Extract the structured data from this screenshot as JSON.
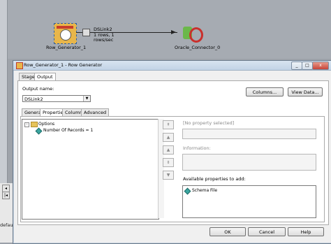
{
  "canvas": {
    "stages": [
      {
        "name": "Row_Generator_1"
      },
      {
        "name": "Oracle_Connector_0"
      }
    ],
    "link": {
      "name": "DSLink2",
      "rate_line1": "1 rows, 1",
      "rate_line2": "rows/sec"
    },
    "bottom_label": "default"
  },
  "dialog": {
    "title": "Row_Generator_1 - Row Generator",
    "window_buttons": [
      "_",
      "□",
      "x"
    ],
    "stage_tabs": [
      {
        "label": "Stage"
      },
      {
        "label": "Output"
      }
    ],
    "output_name_label": "Output name:",
    "output_name_value": "DSLink2",
    "columns_button": "Columns...",
    "view_data_button": "View Data...",
    "sub_tabs": [
      {
        "label": "General"
      },
      {
        "label": "Properties"
      },
      {
        "label": "Columns"
      },
      {
        "label": "Advanced"
      }
    ],
    "tree": {
      "root": {
        "expander": "-",
        "label": "Options"
      },
      "children": [
        {
          "label": "Number Of Records = 1"
        }
      ]
    },
    "side_buttons": [
      "⇞",
      "▲",
      "▲",
      "⇟",
      "▼"
    ],
    "no_property_placeholder": "[No property selected]",
    "information_label": "Information:",
    "available_label": "Available properties to add:",
    "available_items": [
      {
        "label": "Schema File"
      }
    ],
    "footer": {
      "ok": "OK",
      "cancel": "Cancel",
      "help": "Help"
    }
  }
}
